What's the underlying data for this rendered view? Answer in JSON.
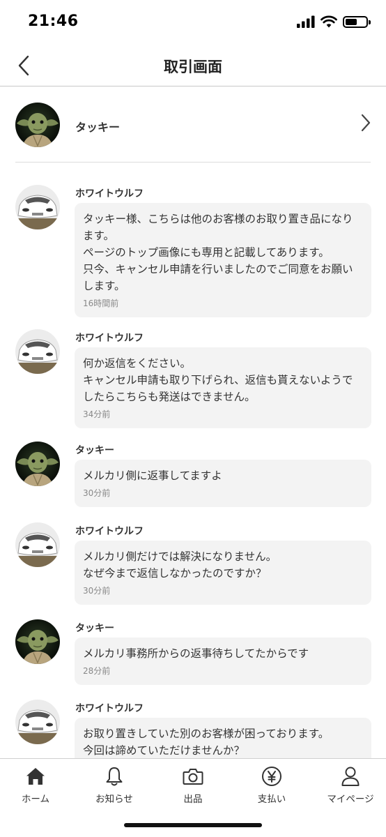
{
  "status_bar": {
    "time": "21:46"
  },
  "nav": {
    "title": "取引画面"
  },
  "partner": {
    "name": "タッキー"
  },
  "messages": [
    {
      "sender": "ホワイトウルフ",
      "avatar": "white-car",
      "text": "タッキー様、こちらは他のお客様のお取り置き品になります。\nページのトップ画像にも専用と記載してあります。\n只今、キャンセル申請を行いましたのでご同意をお願いします。",
      "time": "16時間前"
    },
    {
      "sender": "ホワイトウルフ",
      "avatar": "white-car",
      "text": "何か返信をください。\nキャンセル申請も取り下げられ、返信も貰えないようでしたらこちらも発送はできません。",
      "time": "34分前"
    },
    {
      "sender": "タッキー",
      "avatar": "yoda",
      "text": "メルカリ側に返事してますよ",
      "time": "30分前"
    },
    {
      "sender": "ホワイトウルフ",
      "avatar": "white-car",
      "text": "メルカリ側だけでは解決になりません。\nなぜ今まで返信しなかったのですか？",
      "time": "30分前"
    },
    {
      "sender": "タッキー",
      "avatar": "yoda",
      "text": "メルカリ事務所からの返事待ちしてたからです",
      "time": "28分前"
    },
    {
      "sender": "ホワイトウルフ",
      "avatar": "white-car",
      "text": "お取り置きしていた別のお客様が困っております。\n今回は諦めていただけませんか？",
      "time": ""
    }
  ],
  "tabs": [
    {
      "label": "ホーム",
      "icon": "home-icon"
    },
    {
      "label": "お知らせ",
      "icon": "bell-icon"
    },
    {
      "label": "出品",
      "icon": "camera-icon"
    },
    {
      "label": "支払い",
      "icon": "yen-icon"
    },
    {
      "label": "マイページ",
      "icon": "person-icon"
    }
  ]
}
